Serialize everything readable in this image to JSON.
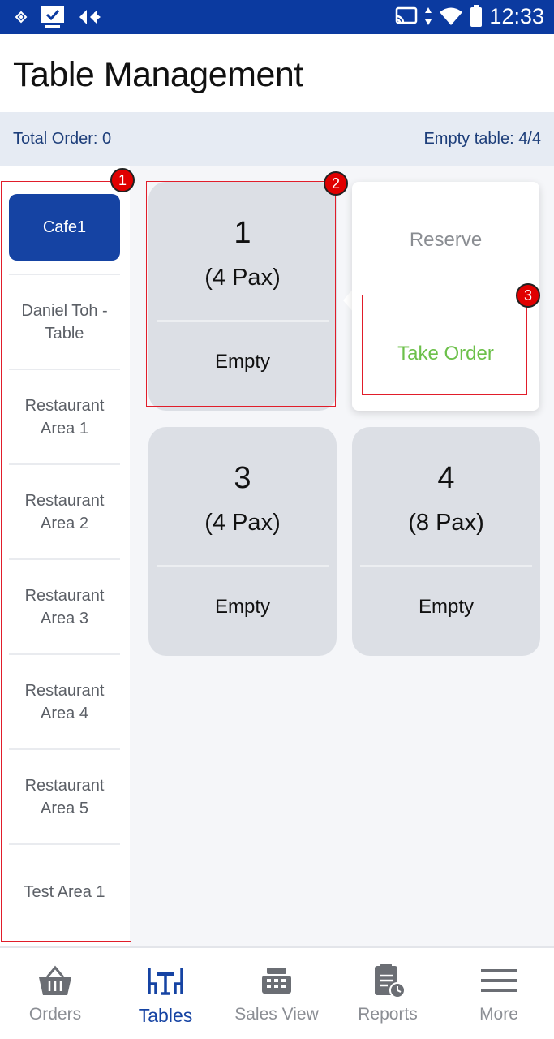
{
  "status_bar": {
    "time": "12:33",
    "left_icons": [
      "signal-small-icon",
      "download-check-icon",
      "navigation-icon"
    ],
    "right_icons": [
      "cast-icon",
      "data-arrows-icon",
      "wifi-icon",
      "battery-icon"
    ]
  },
  "header": {
    "title": "Table Management"
  },
  "summary": {
    "total_order": "Total Order: 0",
    "empty_table": "Empty table: 4/4"
  },
  "areas": [
    {
      "label": "Cafe1",
      "active": true
    },
    {
      "label": "Daniel Toh - Table",
      "active": false
    },
    {
      "label": "Restaurant Area 1",
      "active": false
    },
    {
      "label": "Restaurant Area 2",
      "active": false
    },
    {
      "label": "Restaurant Area 3",
      "active": false
    },
    {
      "label": "Restaurant Area 4",
      "active": false
    },
    {
      "label": "Restaurant Area 5",
      "active": false
    },
    {
      "label": "Test Area 1",
      "active": false
    }
  ],
  "tables": [
    {
      "number": "1",
      "pax": "(4 Pax)",
      "status": "Empty"
    },
    {
      "number": "3",
      "pax": "(4 Pax)",
      "status": "Empty"
    },
    {
      "number": "4",
      "pax": "(8 Pax)",
      "status": "Empty"
    }
  ],
  "popup": {
    "reserve": "Reserve",
    "take_order": "Take Order"
  },
  "annotations": [
    "1",
    "2",
    "3"
  ],
  "bottom_nav": [
    {
      "label": "Orders",
      "icon": "basket-icon",
      "active": false
    },
    {
      "label": "Tables",
      "icon": "tables-icon",
      "active": true
    },
    {
      "label": "Sales View",
      "icon": "cash-register-icon",
      "active": false
    },
    {
      "label": "Reports",
      "icon": "report-clipboard-icon",
      "active": false
    },
    {
      "label": "More",
      "icon": "hamburger-menu-icon",
      "active": false
    }
  ],
  "colors": {
    "status_bar": "#0b3aa0",
    "accent": "#1543a3",
    "take_order": "#6cc04a",
    "annotation": "#e11d2a"
  }
}
